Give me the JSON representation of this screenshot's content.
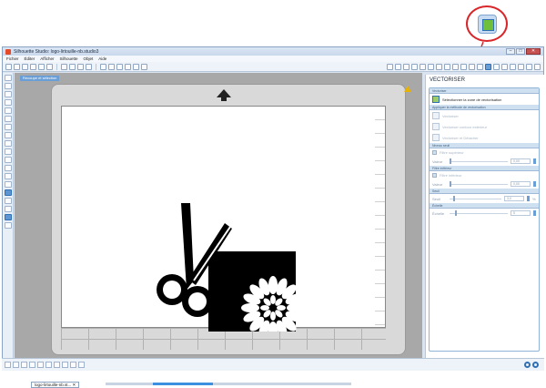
{
  "window": {
    "title": "Silhouette Studio: logo-lirtouille-nb.studio3",
    "controls": [
      "–",
      "□",
      "✕"
    ]
  },
  "menu": [
    "Fichier",
    "Éditer",
    "Afficher",
    "Silhouette",
    "Objet",
    "Aide"
  ],
  "canvas": {
    "badge": "Recoupe et sélection",
    "doc_tab": "logo-lirtouille-nb.st..."
  },
  "panel": {
    "title": "VECTORISER",
    "section_area": "Vectoriser",
    "select_area_label": "Sélectionner la zone de vectorisation",
    "section_method": "Appliquer la méthode de vectorisation",
    "method_options": [
      "Vectoriser",
      "Vectoriser contour extérieur",
      "Vectoriser et Détacher"
    ],
    "section_threshold": "Niveau seuil",
    "high_filter_label": "Filtre supérieur",
    "high_filter_field": "Valeur",
    "high_filter_value": "0,00",
    "section_low": "Filtre inférieur",
    "low_filter_label": "Filtre inférieur",
    "low_filter_field": "Valeur",
    "low_filter_value": "0,00",
    "section_threshold2": "Seuil",
    "threshold_field": "Seuil",
    "threshold_value": "3,0",
    "threshold_unit": "%",
    "section_scale": "Échelle",
    "scale_field": "Échelle",
    "scale_value": "5"
  },
  "colors": {
    "highlight": "#d8262a",
    "accent": "#2f6fb3",
    "trace_green": "#6fbf3a"
  }
}
